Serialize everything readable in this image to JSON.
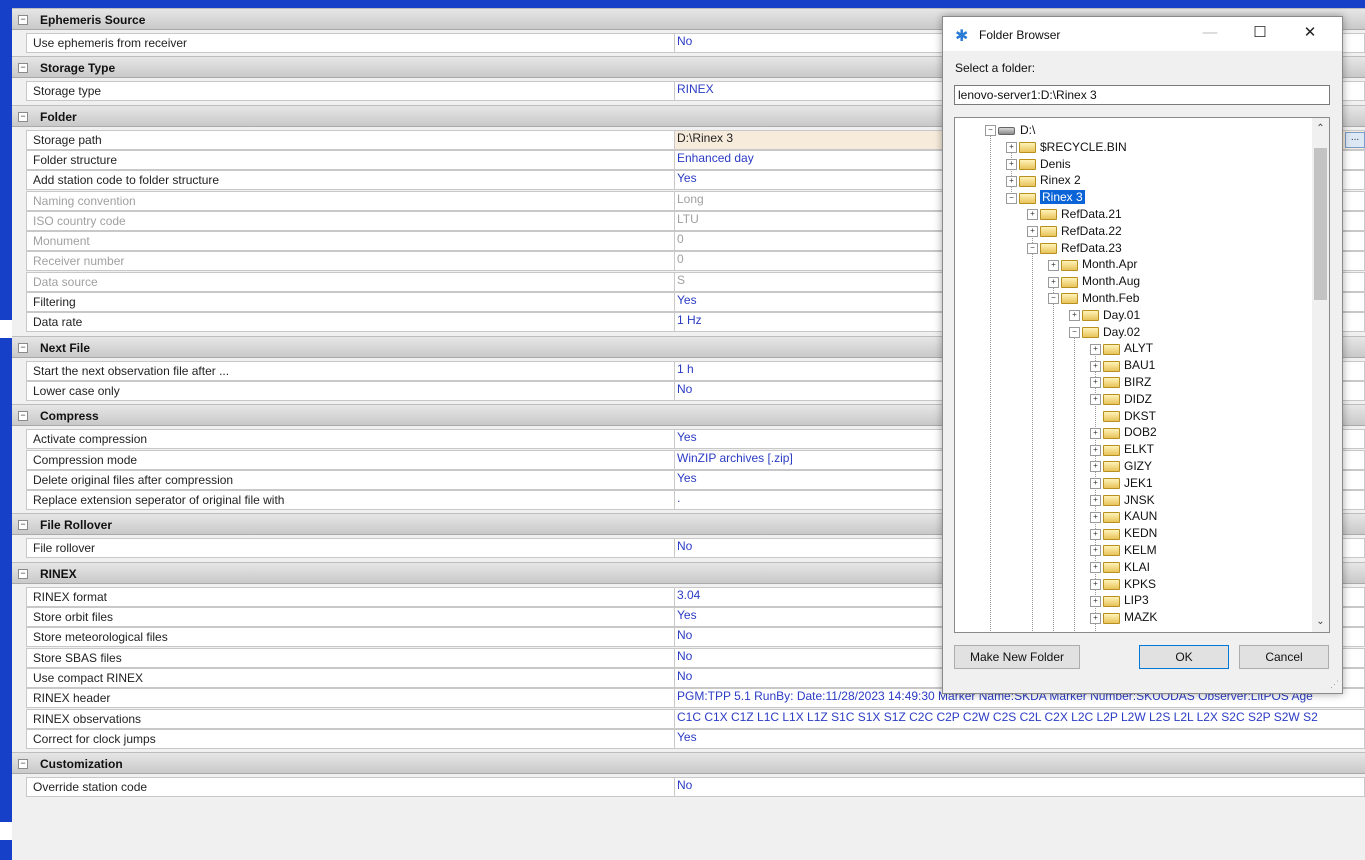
{
  "grid": {
    "sections": [
      {
        "title": "Ephemeris Source",
        "props": [
          {
            "name": "Use ephemeris from receiver",
            "value": "No"
          }
        ]
      },
      {
        "title": "Storage Type",
        "props": [
          {
            "name": "Storage type",
            "value": "RINEX"
          }
        ]
      },
      {
        "title": "Folder",
        "props": [
          {
            "name": "Storage path",
            "value": "D:\\Rinex 3",
            "state": "selected"
          },
          {
            "name": "Folder structure",
            "value": "Enhanced day"
          },
          {
            "name": "Add station code to folder structure",
            "value": "Yes"
          },
          {
            "name": "Naming convention",
            "value": "Long",
            "state": "disabled"
          },
          {
            "name": "ISO country code",
            "value": "LTU",
            "state": "disabled"
          },
          {
            "name": "Monument",
            "value": "0",
            "state": "disabled"
          },
          {
            "name": "Receiver number",
            "value": "0",
            "state": "disabled"
          },
          {
            "name": "Data source",
            "value": "S",
            "state": "disabled"
          },
          {
            "name": "Filtering",
            "value": "Yes"
          },
          {
            "name": "Data rate",
            "value": "1 Hz"
          }
        ]
      },
      {
        "title": "Next File",
        "props": [
          {
            "name": "Start the next observation file after ...",
            "value": "1 h"
          },
          {
            "name": "Lower case only",
            "value": "No"
          }
        ]
      },
      {
        "title": "Compress",
        "props": [
          {
            "name": "Activate compression",
            "value": "Yes"
          },
          {
            "name": "Compression mode",
            "value": "WinZIP archives [.zip]"
          },
          {
            "name": "Delete original files after compression",
            "value": "Yes"
          },
          {
            "name": "Replace extension seperator of original file with",
            "value": "."
          }
        ]
      },
      {
        "title": "File Rollover",
        "props": [
          {
            "name": "File rollover",
            "value": "No"
          }
        ]
      },
      {
        "title": "RINEX",
        "props": [
          {
            "name": "RINEX format",
            "value": "3.04"
          },
          {
            "name": "Store orbit files",
            "value": "Yes"
          },
          {
            "name": "Store meteorological files",
            "value": "No"
          },
          {
            "name": "Store SBAS files",
            "value": "No"
          },
          {
            "name": "Use compact RINEX",
            "value": "No"
          },
          {
            "name": "RINEX header",
            "value": "PGM:TPP 5.1 RunBy: Date:11/28/2023 14:49:30 Marker Name:SKDA Marker Number:SKUODAS Observer:LitPOS Age"
          },
          {
            "name": "RINEX observations",
            "value": "C1C C1X C1Z L1C L1X L1Z S1C S1X S1Z C2C C2P C2W C2S C2L C2X L2C L2P L2W L2S L2L L2X S2C S2P S2W S2"
          },
          {
            "name": "Correct for clock jumps",
            "value": "Yes"
          }
        ]
      },
      {
        "title": "Customization",
        "props": [
          {
            "name": "Override station code",
            "value": "No"
          }
        ]
      }
    ],
    "ellipsis_label": "..."
  },
  "dialog": {
    "title": "Folder Browser",
    "minimize": "—",
    "maximize": "☐",
    "close": "✕",
    "select_label": "Select a folder:",
    "path_value": "lenovo-server1:D:\\Rinex 3",
    "tree": [
      {
        "label": "D:\\",
        "level": 0,
        "exp": "-",
        "kind": "drive"
      },
      {
        "label": "$RECYCLE.BIN",
        "level": 1,
        "exp": "+"
      },
      {
        "label": "Denis",
        "level": 1,
        "exp": "+"
      },
      {
        "label": "Rinex 2",
        "level": 1,
        "exp": "+"
      },
      {
        "label": "Rinex 3",
        "level": 1,
        "exp": "-",
        "selected": true
      },
      {
        "label": "RefData.21",
        "level": 2,
        "exp": "+"
      },
      {
        "label": "RefData.22",
        "level": 2,
        "exp": "+"
      },
      {
        "label": "RefData.23",
        "level": 2,
        "exp": "-"
      },
      {
        "label": "Month.Apr",
        "level": 3,
        "exp": "+"
      },
      {
        "label": "Month.Aug",
        "level": 3,
        "exp": "+"
      },
      {
        "label": "Month.Feb",
        "level": 3,
        "exp": "-"
      },
      {
        "label": "Day.01",
        "level": 4,
        "exp": "+"
      },
      {
        "label": "Day.02",
        "level": 4,
        "exp": "-"
      },
      {
        "label": "ALYT",
        "level": 5,
        "exp": "+"
      },
      {
        "label": "BAU1",
        "level": 5,
        "exp": "+"
      },
      {
        "label": "BIRZ",
        "level": 5,
        "exp": "+"
      },
      {
        "label": "DIDZ",
        "level": 5,
        "exp": "+"
      },
      {
        "label": "DKST",
        "level": 5,
        "exp": ""
      },
      {
        "label": "DOB2",
        "level": 5,
        "exp": "+"
      },
      {
        "label": "ELKT",
        "level": 5,
        "exp": "+"
      },
      {
        "label": "GIZY",
        "level": 5,
        "exp": "+"
      },
      {
        "label": "JEK1",
        "level": 5,
        "exp": "+"
      },
      {
        "label": "JNSK",
        "level": 5,
        "exp": "+"
      },
      {
        "label": "KAUN",
        "level": 5,
        "exp": "+"
      },
      {
        "label": "KEDN",
        "level": 5,
        "exp": "+"
      },
      {
        "label": "KELM",
        "level": 5,
        "exp": "+"
      },
      {
        "label": "KLAI",
        "level": 5,
        "exp": "+"
      },
      {
        "label": "KPKS",
        "level": 5,
        "exp": "+"
      },
      {
        "label": "LIP3",
        "level": 5,
        "exp": "+"
      },
      {
        "label": "MAZK",
        "level": 5,
        "exp": "+"
      }
    ],
    "scroll_up": "⌃",
    "scroll_down": "⌄",
    "buttons": {
      "new_folder": "Make New Folder",
      "ok": "OK",
      "cancel": "Cancel"
    }
  }
}
